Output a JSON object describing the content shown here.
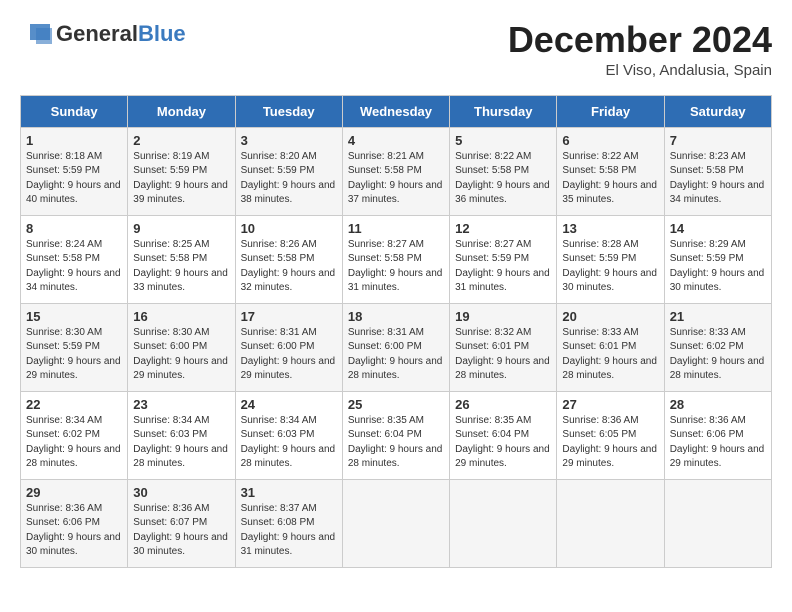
{
  "logo": {
    "general": "General",
    "blue": "Blue"
  },
  "title": "December 2024",
  "location": "El Viso, Andalusia, Spain",
  "days_of_week": [
    "Sunday",
    "Monday",
    "Tuesday",
    "Wednesday",
    "Thursday",
    "Friday",
    "Saturday"
  ],
  "weeks": [
    [
      {
        "day": "1",
        "sunrise": "Sunrise: 8:18 AM",
        "sunset": "Sunset: 5:59 PM",
        "daylight": "Daylight: 9 hours and 40 minutes."
      },
      {
        "day": "2",
        "sunrise": "Sunrise: 8:19 AM",
        "sunset": "Sunset: 5:59 PM",
        "daylight": "Daylight: 9 hours and 39 minutes."
      },
      {
        "day": "3",
        "sunrise": "Sunrise: 8:20 AM",
        "sunset": "Sunset: 5:59 PM",
        "daylight": "Daylight: 9 hours and 38 minutes."
      },
      {
        "day": "4",
        "sunrise": "Sunrise: 8:21 AM",
        "sunset": "Sunset: 5:58 PM",
        "daylight": "Daylight: 9 hours and 37 minutes."
      },
      {
        "day": "5",
        "sunrise": "Sunrise: 8:22 AM",
        "sunset": "Sunset: 5:58 PM",
        "daylight": "Daylight: 9 hours and 36 minutes."
      },
      {
        "day": "6",
        "sunrise": "Sunrise: 8:22 AM",
        "sunset": "Sunset: 5:58 PM",
        "daylight": "Daylight: 9 hours and 35 minutes."
      },
      {
        "day": "7",
        "sunrise": "Sunrise: 8:23 AM",
        "sunset": "Sunset: 5:58 PM",
        "daylight": "Daylight: 9 hours and 34 minutes."
      }
    ],
    [
      {
        "day": "8",
        "sunrise": "Sunrise: 8:24 AM",
        "sunset": "Sunset: 5:58 PM",
        "daylight": "Daylight: 9 hours and 34 minutes."
      },
      {
        "day": "9",
        "sunrise": "Sunrise: 8:25 AM",
        "sunset": "Sunset: 5:58 PM",
        "daylight": "Daylight: 9 hours and 33 minutes."
      },
      {
        "day": "10",
        "sunrise": "Sunrise: 8:26 AM",
        "sunset": "Sunset: 5:58 PM",
        "daylight": "Daylight: 9 hours and 32 minutes."
      },
      {
        "day": "11",
        "sunrise": "Sunrise: 8:27 AM",
        "sunset": "Sunset: 5:58 PM",
        "daylight": "Daylight: 9 hours and 31 minutes."
      },
      {
        "day": "12",
        "sunrise": "Sunrise: 8:27 AM",
        "sunset": "Sunset: 5:59 PM",
        "daylight": "Daylight: 9 hours and 31 minutes."
      },
      {
        "day": "13",
        "sunrise": "Sunrise: 8:28 AM",
        "sunset": "Sunset: 5:59 PM",
        "daylight": "Daylight: 9 hours and 30 minutes."
      },
      {
        "day": "14",
        "sunrise": "Sunrise: 8:29 AM",
        "sunset": "Sunset: 5:59 PM",
        "daylight": "Daylight: 9 hours and 30 minutes."
      }
    ],
    [
      {
        "day": "15",
        "sunrise": "Sunrise: 8:30 AM",
        "sunset": "Sunset: 5:59 PM",
        "daylight": "Daylight: 9 hours and 29 minutes."
      },
      {
        "day": "16",
        "sunrise": "Sunrise: 8:30 AM",
        "sunset": "Sunset: 6:00 PM",
        "daylight": "Daylight: 9 hours and 29 minutes."
      },
      {
        "day": "17",
        "sunrise": "Sunrise: 8:31 AM",
        "sunset": "Sunset: 6:00 PM",
        "daylight": "Daylight: 9 hours and 29 minutes."
      },
      {
        "day": "18",
        "sunrise": "Sunrise: 8:31 AM",
        "sunset": "Sunset: 6:00 PM",
        "daylight": "Daylight: 9 hours and 28 minutes."
      },
      {
        "day": "19",
        "sunrise": "Sunrise: 8:32 AM",
        "sunset": "Sunset: 6:01 PM",
        "daylight": "Daylight: 9 hours and 28 minutes."
      },
      {
        "day": "20",
        "sunrise": "Sunrise: 8:33 AM",
        "sunset": "Sunset: 6:01 PM",
        "daylight": "Daylight: 9 hours and 28 minutes."
      },
      {
        "day": "21",
        "sunrise": "Sunrise: 8:33 AM",
        "sunset": "Sunset: 6:02 PM",
        "daylight": "Daylight: 9 hours and 28 minutes."
      }
    ],
    [
      {
        "day": "22",
        "sunrise": "Sunrise: 8:34 AM",
        "sunset": "Sunset: 6:02 PM",
        "daylight": "Daylight: 9 hours and 28 minutes."
      },
      {
        "day": "23",
        "sunrise": "Sunrise: 8:34 AM",
        "sunset": "Sunset: 6:03 PM",
        "daylight": "Daylight: 9 hours and 28 minutes."
      },
      {
        "day": "24",
        "sunrise": "Sunrise: 8:34 AM",
        "sunset": "Sunset: 6:03 PM",
        "daylight": "Daylight: 9 hours and 28 minutes."
      },
      {
        "day": "25",
        "sunrise": "Sunrise: 8:35 AM",
        "sunset": "Sunset: 6:04 PM",
        "daylight": "Daylight: 9 hours and 28 minutes."
      },
      {
        "day": "26",
        "sunrise": "Sunrise: 8:35 AM",
        "sunset": "Sunset: 6:04 PM",
        "daylight": "Daylight: 9 hours and 29 minutes."
      },
      {
        "day": "27",
        "sunrise": "Sunrise: 8:36 AM",
        "sunset": "Sunset: 6:05 PM",
        "daylight": "Daylight: 9 hours and 29 minutes."
      },
      {
        "day": "28",
        "sunrise": "Sunrise: 8:36 AM",
        "sunset": "Sunset: 6:06 PM",
        "daylight": "Daylight: 9 hours and 29 minutes."
      }
    ],
    [
      {
        "day": "29",
        "sunrise": "Sunrise: 8:36 AM",
        "sunset": "Sunset: 6:06 PM",
        "daylight": "Daylight: 9 hours and 30 minutes."
      },
      {
        "day": "30",
        "sunrise": "Sunrise: 8:36 AM",
        "sunset": "Sunset: 6:07 PM",
        "daylight": "Daylight: 9 hours and 30 minutes."
      },
      {
        "day": "31",
        "sunrise": "Sunrise: 8:37 AM",
        "sunset": "Sunset: 6:08 PM",
        "daylight": "Daylight: 9 hours and 31 minutes."
      },
      null,
      null,
      null,
      null
    ]
  ]
}
